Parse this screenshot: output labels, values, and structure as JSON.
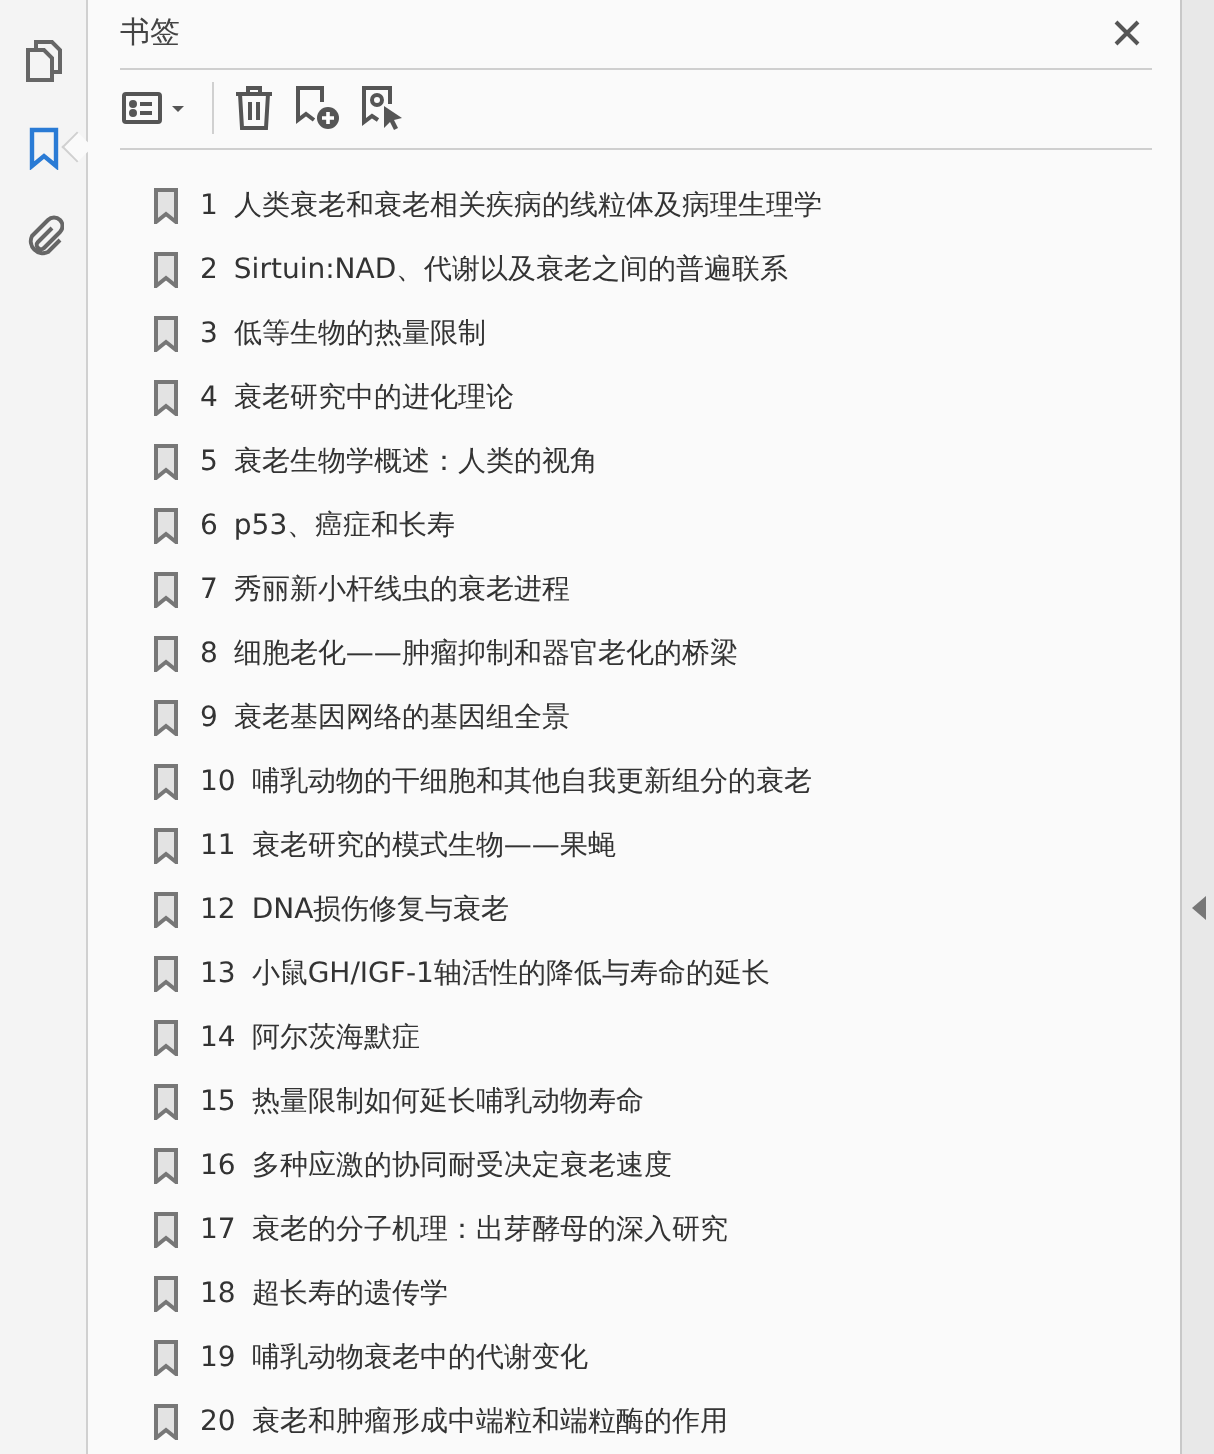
{
  "rail": [
    {
      "kind": "pages",
      "selected": false
    },
    {
      "kind": "bookmarks",
      "selected": true
    },
    {
      "kind": "attachments",
      "selected": false
    }
  ],
  "panel": {
    "title": "书签",
    "toolbar": [
      {
        "kind": "options"
      },
      {
        "kind": "delete"
      },
      {
        "kind": "new"
      },
      {
        "kind": "find"
      }
    ]
  },
  "bookmarks": [
    {
      "number": "1",
      "title": "人类衰老和衰老相关疾病的线粒体及病理生理学"
    },
    {
      "number": "2",
      "title": "Sirtuin:NAD、代谢以及衰老之间的普遍联系"
    },
    {
      "number": "3",
      "title": "低等生物的热量限制"
    },
    {
      "number": "4",
      "title": "衰老研究中的进化理论"
    },
    {
      "number": "5",
      "title": "衰老生物学概述：人类的视角"
    },
    {
      "number": "6",
      "title": "p53、癌症和长寿"
    },
    {
      "number": "7",
      "title": "秀丽新小杆线虫的衰老进程"
    },
    {
      "number": "8",
      "title": "细胞老化——肿瘤抑制和器官老化的桥梁"
    },
    {
      "number": "9",
      "title": "衰老基因网络的基因组全景"
    },
    {
      "number": "10",
      "title": "哺乳动物的干细胞和其他自我更新组分的衰老"
    },
    {
      "number": "11",
      "title": "衰老研究的模式生物——果蝇"
    },
    {
      "number": "12",
      "title": "DNA损伤修复与衰老"
    },
    {
      "number": "13",
      "title": "小鼠GH/IGF-1轴活性的降低与寿命的延长"
    },
    {
      "number": "14",
      "title": "阿尔茨海默症"
    },
    {
      "number": "15",
      "title": "热量限制如何延长哺乳动物寿命"
    },
    {
      "number": "16",
      "title": "多种应激的协同耐受决定衰老速度"
    },
    {
      "number": "17",
      "title": "衰老的分子机理：出芽酵母的深入研究"
    },
    {
      "number": "18",
      "title": "超长寿的遗传学"
    },
    {
      "number": "19",
      "title": "哺乳动物衰老中的代谢变化"
    },
    {
      "number": "20",
      "title": "衰老和肿瘤形成中端粒和端粒酶的作用"
    }
  ]
}
